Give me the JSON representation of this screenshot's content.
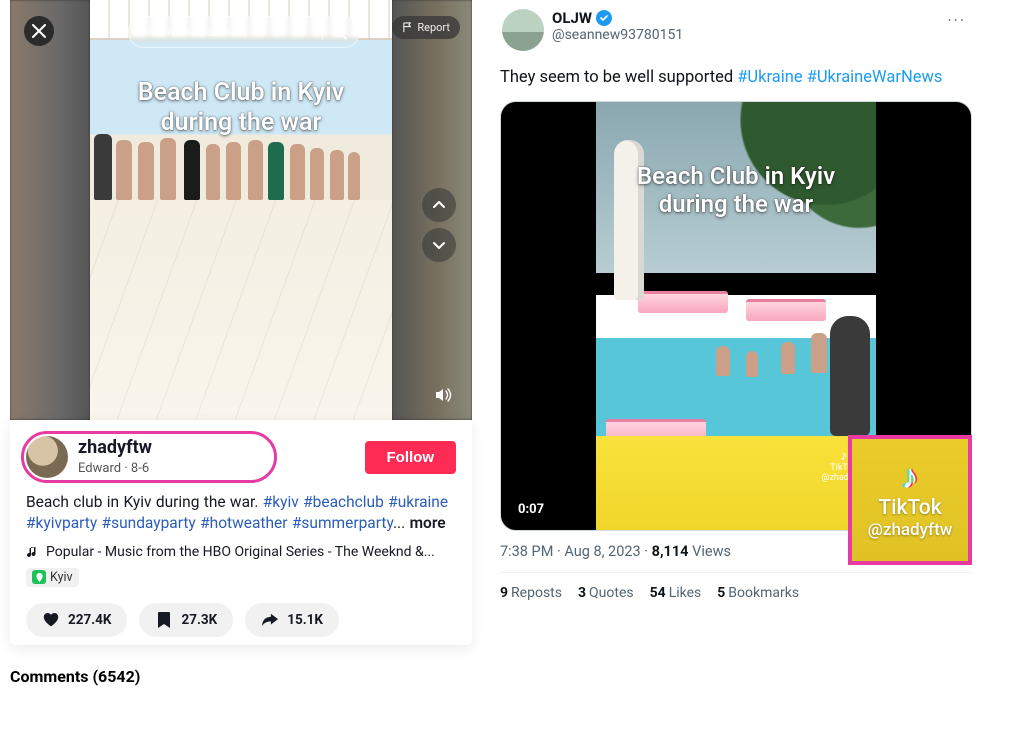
{
  "tiktok": {
    "search_placeholder": "Find related content",
    "report_label": "Report",
    "overlay_line1": "Beach Club in Kyiv",
    "overlay_line2": "during the war",
    "username": "zhadyftw",
    "display_name": "Edward",
    "sub_separator": " · ",
    "date": "8-6",
    "follow_label": "Follow",
    "caption_plain": "Beach club in Kyiv during the war. ",
    "hashtags": [
      "#kyiv",
      "#beachclub",
      "#ukraine",
      "#kyivparty",
      "#sundayparty",
      "#hotweather",
      "#summerparty"
    ],
    "caption_trail": "...",
    "more_label": "more",
    "music": "Popular - Music from the HBO Original Series - The Weeknd &...",
    "location": "Kyiv",
    "likes": "227.4K",
    "bookmarks": "27.3K",
    "shares": "15.1K",
    "comments_label": "Comments",
    "comments_count": "(6542)"
  },
  "twitter": {
    "display_name": "OLJW",
    "handle": "@seannew93780151",
    "more_glyph": "···",
    "body_plain": "They seem to be well supported ",
    "hashtags": [
      "#Ukraine",
      "#UkraineWarNews"
    ],
    "video_overlay_line1": "Beach Club in Kyiv",
    "video_overlay_line2": "during the war",
    "watermark_brand": "TikTok",
    "watermark_handle": "@zhadyftw",
    "duration": "0:07",
    "timestamp": "7:38 PM · Aug 8, 2023",
    "views_count": "8,114",
    "views_label": "Views",
    "reposts_n": "9",
    "reposts_l": "Reposts",
    "quotes_n": "3",
    "quotes_l": "Quotes",
    "likes_n": "54",
    "likes_l": "Likes",
    "bookmarks_n": "5",
    "bookmarks_l": "Bookmarks"
  },
  "inset": {
    "brand": "TikTok",
    "handle": "@zhadyftw"
  }
}
